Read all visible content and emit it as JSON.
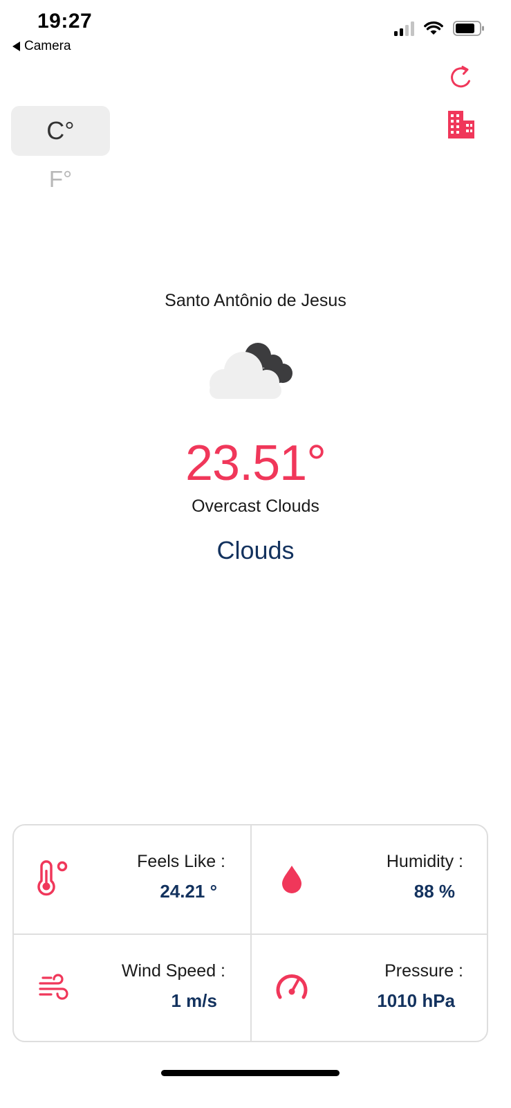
{
  "status_bar": {
    "time": "19:27",
    "back_label": "Camera"
  },
  "actions": {
    "refresh_icon": "refresh-icon",
    "city_icon": "building-icon"
  },
  "units": {
    "celsius": "C°",
    "fahrenheit": "F°",
    "selected": "C°"
  },
  "weather": {
    "city": "Santo Antônio de Jesus",
    "icon": "cloudy-icon",
    "temperature": "23.51°",
    "description": "Overcast Clouds",
    "main": "Clouds"
  },
  "stats": {
    "feels_like": {
      "label": "Feels Like :",
      "value": "24.21 °"
    },
    "humidity": {
      "label": "Humidity :",
      "value": "88 %"
    },
    "wind_speed": {
      "label": "Wind Speed :",
      "value": "1 m/s"
    },
    "pressure": {
      "label": "Pressure :",
      "value": "1010 hPa"
    }
  },
  "colors": {
    "accent": "#f0375a",
    "navy": "#13325e",
    "toggle_bg": "#eeeeee"
  }
}
